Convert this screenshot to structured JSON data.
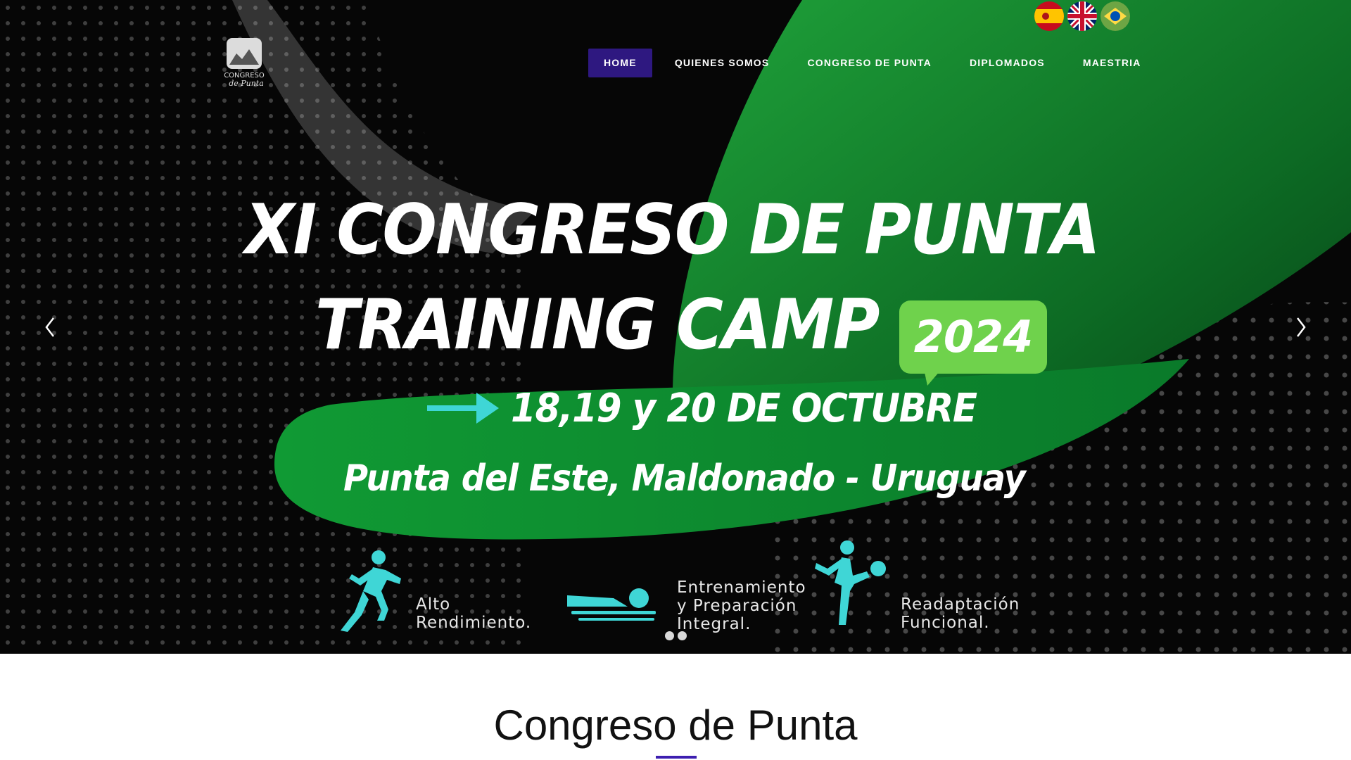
{
  "header": {
    "logo_alt": "Congreso de Punta",
    "nav": [
      {
        "label": "HOME",
        "active": true
      },
      {
        "label": "QUIENES SOMOS"
      },
      {
        "label": "CONGRESO DE PUNTA"
      },
      {
        "label": "DIPLOMADOS"
      },
      {
        "label": "MAESTRIA"
      }
    ],
    "languages": [
      "spanish-flag-icon",
      "uk-flag-icon",
      "brazil-flag-icon"
    ],
    "active_color": "#2e1880"
  },
  "hero": {
    "line1": "XI CONGRESO DE PUNTA",
    "line2": "TRAINING CAMP",
    "year": "2024",
    "dates": "18,19 y 20 DE OCTUBRE",
    "location": "Punta del Este, Maldonado - Uruguay",
    "features": [
      {
        "icon": "runner-icon",
        "line1": "Alto",
        "line2": "Rendimiento."
      },
      {
        "icon": "swimmer-icon",
        "line1": "Entrenamiento",
        "line2": "y Preparación",
        "line3": "Integral."
      },
      {
        "icon": "kicker-icon",
        "line1": "Readaptación",
        "line2": "Funcional."
      }
    ],
    "slide_count": 2,
    "active_slide": 1,
    "accent_green": "#6fd24c",
    "accent_cyan": "#3fd6d6"
  },
  "section": {
    "title": "Congreso de Punta",
    "underline_color": "#3d1fb0"
  }
}
